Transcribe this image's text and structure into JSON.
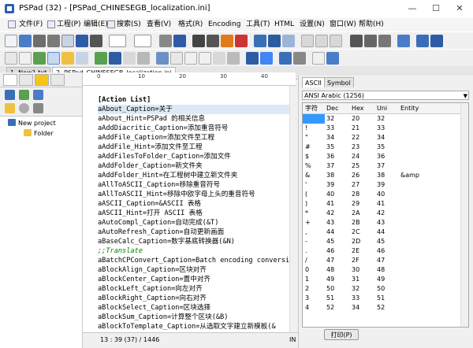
{
  "window": {
    "title": "PSPad (32) - [PSPad_CHINESEGB_localization.ini]",
    "minimize": "—",
    "maximize": "☐",
    "close": "✕"
  },
  "menu": [
    {
      "label": "文件(F)"
    },
    {
      "label": "工程(P)"
    },
    {
      "label": "编辑(E)"
    },
    {
      "label": "搜索(S)"
    },
    {
      "label": "查看(V)"
    },
    {
      "label": "格式(R)"
    },
    {
      "label": "Encoding"
    },
    {
      "label": "工具(T)"
    },
    {
      "label": "HTML"
    },
    {
      "label": "设置(N)"
    },
    {
      "label": "窗口(W)"
    },
    {
      "label": "帮助(H)"
    }
  ],
  "tabs": [
    {
      "label": "1. New1.txt"
    },
    {
      "label": "2. PSPad_CHINESEGB_localization.ini"
    }
  ],
  "project": {
    "root": "New project",
    "folder": "Folder"
  },
  "ruler": {
    "marks": [
      "0",
      "10",
      "20",
      "30",
      "40"
    ]
  },
  "editor": {
    "lines": [
      "",
      "[Action List]",
      "aAbout_Caption=关于",
      "aAbout_Hint=PSPad 的相关信息",
      "aAddDiacritic_Caption=添加重音符号",
      "aAddFile_Caption=添加文件至工程",
      "aAddFile_Hint=添加文件至工程",
      "aAddFilesToFolder_Caption=添加文件",
      "aAddFolder_Caption=新文件夹",
      "aAddFolder_Hint=在工程树中建立新文件夹",
      "aAllToASCII_Caption=移除重音符号",
      "aAllToASCII_Hint=移除中欧字母上头的重音符号",
      "aASCII_Caption=&ASCII 表格",
      "aASCII_Hint=打开 ASCII 表格",
      "aAutoCompl_Caption=自动完成(&T)",
      "aAutoRefresh_Caption=自动更新画面",
      "aBaseCalc_Caption=数字基底转换器(&N)",
      ";;Translate",
      "aBatchCPConvert_Caption=Batch encoding conversi",
      "aBlockAlign_Caption=区块对齐",
      "aBlockCenter_Caption=置中对齐",
      "aBlockLeft_Caption=向左对齐",
      "aBlockRight_Caption=向右对齐",
      "aBlockSelect_Caption=区块选择",
      "aBlockSum_Caption=计算整个区块(&B)",
      "aBlockToTemplate_Caption=从选取文字建立新模板(&"
    ]
  },
  "status": {
    "position": "13 : 39 (37) / 1446",
    "mode": "IN"
  },
  "ascii": {
    "tabs": [
      "ASCII",
      "Symbol"
    ],
    "codepage": "ANSI Arabic (1256)",
    "headers": [
      "字符",
      "Dec",
      "Hex",
      "Uni",
      "Entity"
    ],
    "rows": [
      [
        "",
        "32",
        "20",
        "32",
        ""
      ],
      [
        "!",
        "33",
        "21",
        "33",
        ""
      ],
      [
        "\"",
        "34",
        "22",
        "34",
        ""
      ],
      [
        "#",
        "35",
        "23",
        "35",
        ""
      ],
      [
        "$",
        "36",
        "24",
        "36",
        ""
      ],
      [
        "%",
        "37",
        "25",
        "37",
        ""
      ],
      [
        "&",
        "38",
        "26",
        "38",
        "&amp"
      ],
      [
        "'",
        "39",
        "27",
        "39",
        ""
      ],
      [
        "(",
        "40",
        "28",
        "40",
        ""
      ],
      [
        ")",
        "41",
        "29",
        "41",
        ""
      ],
      [
        "*",
        "42",
        "2A",
        "42",
        ""
      ],
      [
        "+",
        "43",
        "2B",
        "43",
        ""
      ],
      [
        ",",
        "44",
        "2C",
        "44",
        ""
      ],
      [
        "-",
        "45",
        "2D",
        "45",
        ""
      ],
      [
        ".",
        "46",
        "2E",
        "46",
        ""
      ],
      [
        "/",
        "47",
        "2F",
        "47",
        ""
      ],
      [
        "0",
        "48",
        "30",
        "48",
        ""
      ],
      [
        "1",
        "49",
        "31",
        "49",
        ""
      ],
      [
        "2",
        "50",
        "32",
        "50",
        ""
      ],
      [
        "3",
        "51",
        "33",
        "51",
        ""
      ],
      [
        "4",
        "52",
        "34",
        "52",
        ""
      ]
    ],
    "print_button": "打印(P)"
  }
}
